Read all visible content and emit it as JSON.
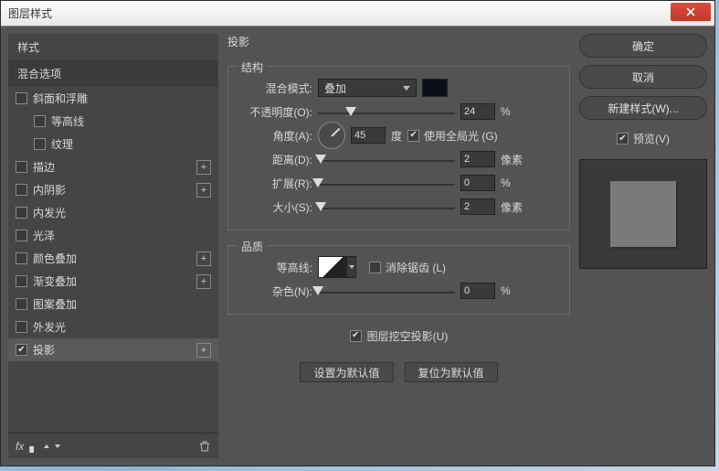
{
  "window": {
    "title": "图层样式"
  },
  "sidebar": {
    "header": "样式",
    "subheader": "混合选项",
    "items": [
      {
        "label": "斜面和浮雕",
        "checked": false,
        "plus": false,
        "indent": false
      },
      {
        "label": "等高线",
        "checked": false,
        "plus": false,
        "indent": true
      },
      {
        "label": "纹理",
        "checked": false,
        "plus": false,
        "indent": true
      },
      {
        "label": "描边",
        "checked": false,
        "plus": true,
        "indent": false
      },
      {
        "label": "内阴影",
        "checked": false,
        "plus": true,
        "indent": false
      },
      {
        "label": "内发光",
        "checked": false,
        "plus": false,
        "indent": false
      },
      {
        "label": "光泽",
        "checked": false,
        "plus": false,
        "indent": false
      },
      {
        "label": "颜色叠加",
        "checked": false,
        "plus": true,
        "indent": false
      },
      {
        "label": "渐变叠加",
        "checked": false,
        "plus": true,
        "indent": false
      },
      {
        "label": "图案叠加",
        "checked": false,
        "plus": false,
        "indent": false
      },
      {
        "label": "外发光",
        "checked": false,
        "plus": false,
        "indent": false
      },
      {
        "label": "投影",
        "checked": true,
        "plus": true,
        "indent": false,
        "active": true
      }
    ]
  },
  "center": {
    "title": "投影",
    "structure": {
      "legend": "结构",
      "blendModeLabel": "混合模式:",
      "blendModeValue": "叠加",
      "opacityLabel": "不透明度(O):",
      "opacityValue": "24",
      "opacityUnit": "%",
      "angleLabel": "角度(A):",
      "angleValue": "45",
      "angleUnit": "度",
      "globalLight": "使用全局光 (G)",
      "distanceLabel": "距离(D):",
      "distanceValue": "2",
      "distanceUnit": "像素",
      "spreadLabel": "扩展(R):",
      "spreadValue": "0",
      "spreadUnit": "%",
      "sizeLabel": "大小(S):",
      "sizeValue": "2",
      "sizeUnit": "像素"
    },
    "quality": {
      "legend": "品质",
      "contourLabel": "等高线:",
      "antialias": "消除锯齿 (L)",
      "noiseLabel": "杂色(N):",
      "noiseValue": "0",
      "noiseUnit": "%"
    },
    "knockout": "图层挖空投影(U)",
    "setDefault": "设置为默认值",
    "resetDefault": "复位为默认值"
  },
  "right": {
    "ok": "确定",
    "cancel": "取消",
    "newStyle": "新建样式(W)...",
    "preview": "预览(V)"
  }
}
